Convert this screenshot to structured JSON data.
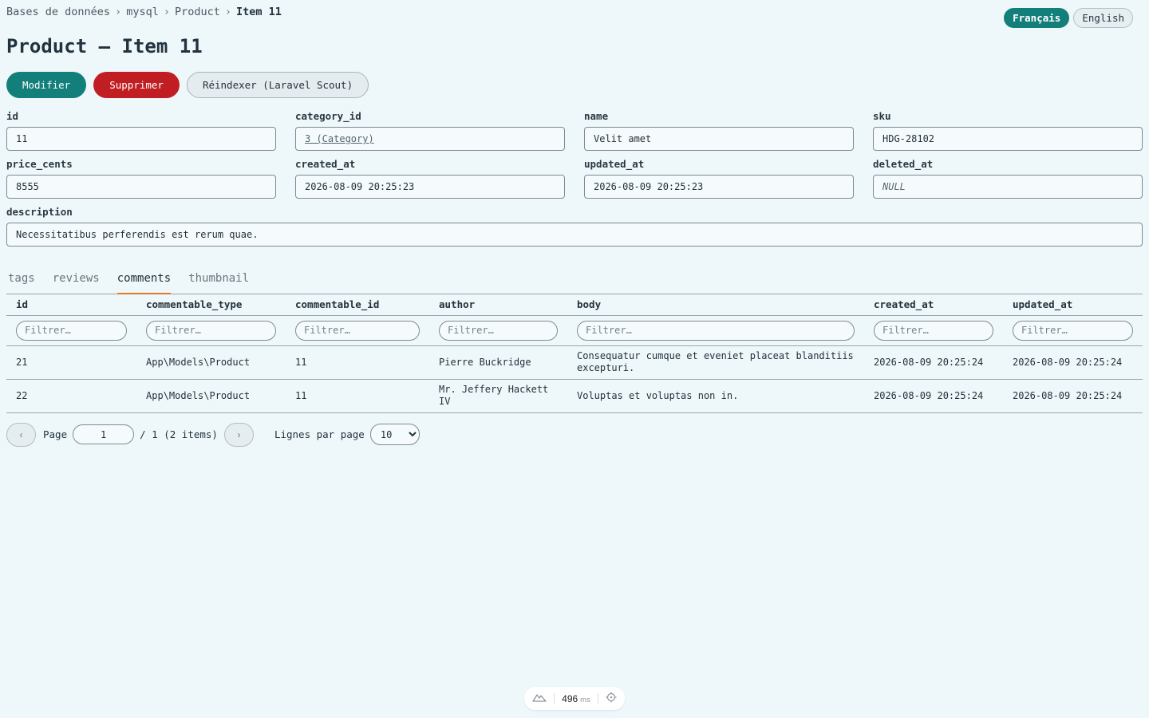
{
  "breadcrumb": {
    "items": [
      "Bases de données",
      "mysql",
      "Product"
    ],
    "current": "Item 11",
    "separator": "›"
  },
  "lang": {
    "fr": "Français",
    "en": "English",
    "active": "fr"
  },
  "title": "Product — Item 11",
  "actions": {
    "edit": "Modifier",
    "delete": "Supprimer",
    "reindex": "Réindexer (Laravel Scout)"
  },
  "fields": {
    "id": {
      "label": "id",
      "value": "11"
    },
    "category_id": {
      "label": "category_id",
      "value": "3 (Category)"
    },
    "name": {
      "label": "name",
      "value": "Velit amet"
    },
    "sku": {
      "label": "sku",
      "value": "HDG-28102"
    },
    "price_cents": {
      "label": "price_cents",
      "value": "8555"
    },
    "created_at": {
      "label": "created_at",
      "value": "2026-08-09 20:25:23"
    },
    "updated_at": {
      "label": "updated_at",
      "value": "2026-08-09 20:25:23"
    },
    "deleted_at": {
      "label": "deleted_at",
      "value": "NULL"
    },
    "description": {
      "label": "description",
      "value": "Necessitatibus perferendis est rerum quae."
    }
  },
  "tabs": [
    {
      "label": "tags",
      "active": false
    },
    {
      "label": "reviews",
      "active": false
    },
    {
      "label": "comments",
      "active": true
    },
    {
      "label": "thumbnail",
      "active": false
    }
  ],
  "table": {
    "columns": [
      "id",
      "commentable_type",
      "commentable_id",
      "author",
      "body",
      "created_at",
      "updated_at"
    ],
    "filter_placeholder": "Filtrer…",
    "rows": [
      [
        "21",
        "App\\Models\\Product",
        "11",
        "Pierre Buckridge",
        "Consequatur cumque et eveniet placeat blanditiis excepturi.",
        "2026-08-09 20:25:24",
        "2026-08-09 20:25:24"
      ],
      [
        "22",
        "App\\Models\\Product",
        "11",
        "Mr. Jeffery Hackett IV",
        "Voluptas et voluptas non in.",
        "2026-08-09 20:25:24",
        "2026-08-09 20:25:24"
      ]
    ]
  },
  "pager": {
    "prev": "‹",
    "next": "›",
    "page_label": "Page",
    "page_value": "1",
    "total": "/ 1 (2 items)",
    "per_page_label": "Lignes par page",
    "per_page_value": "10"
  },
  "debugbar": {
    "time": "496",
    "unit": "ms"
  },
  "colors": {
    "accent": "#137f7b",
    "danger": "#c01e22",
    "tab_active": "#e0782a",
    "background": "#eef8fa"
  }
}
